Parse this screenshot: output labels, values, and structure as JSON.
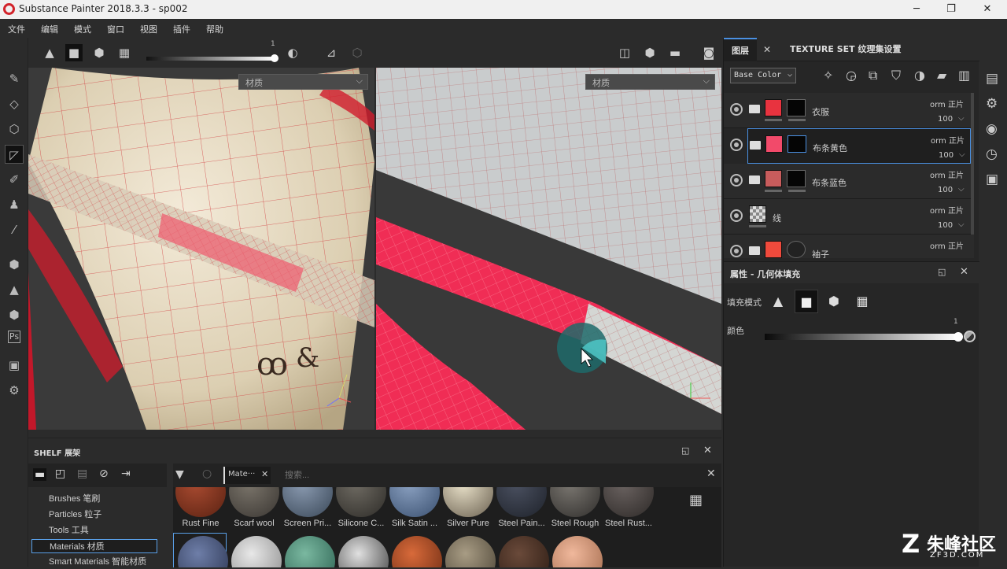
{
  "window": {
    "title": "Substance Painter 2018.3.3 - sp002",
    "min": "─",
    "max": "❐",
    "close": "✕"
  },
  "menu": [
    "文件",
    "编辑",
    "模式",
    "窗口",
    "视图",
    "插件",
    "帮助"
  ],
  "viewport_toolbar": {
    "slider_value": "1"
  },
  "viewport_left": {
    "channel_select": "材质"
  },
  "viewport_right": {
    "channel_select": "材质"
  },
  "shelf": {
    "title": "SHELF 展架",
    "filter_tag": "Mate···",
    "search_placeholder": "搜索...",
    "categories": [
      "Brushes 笔刷",
      "Particles 粒子",
      "Tools 工具",
      "Materials 材质",
      "Smart Materials 智能材质"
    ],
    "selected_category": 3,
    "row1_labels": [
      "Rust Fine",
      "Scarf wool",
      "Screen Pri...",
      "Silicone C...",
      "Silk Satin ...",
      "Silver Pure",
      "Steel Pain...",
      "Steel Rough",
      "Steel Rust..."
    ]
  },
  "layers_panel": {
    "tab_layers": "图层",
    "tab_texture_set": "TEXTURE SET 纹理集设置",
    "channel": "Base Color",
    "layers": [
      {
        "name": "衣服",
        "blend": "orm 正片",
        "opacity": "100",
        "color": "#e8333f"
      },
      {
        "name": "布条黄色",
        "blend": "orm 正片",
        "opacity": "100",
        "color": "#f24a6a"
      },
      {
        "name": "布条蓝色",
        "blend": "orm 正片",
        "opacity": "100",
        "color": "#c85c5c"
      },
      {
        "name": "线",
        "blend": "orm 正片",
        "opacity": "100",
        "color": ""
      },
      {
        "name": "袖子",
        "blend": "orm 正片",
        "opacity": "",
        "color": "#f04a3c"
      }
    ]
  },
  "properties_panel": {
    "title": "属性 - 几何体填充",
    "fill_mode_label": "填充模式",
    "color_label": "颜色",
    "color_value": "1"
  },
  "watermark": {
    "text": "朱峰社区",
    "sub": "ZF3D.COM"
  }
}
